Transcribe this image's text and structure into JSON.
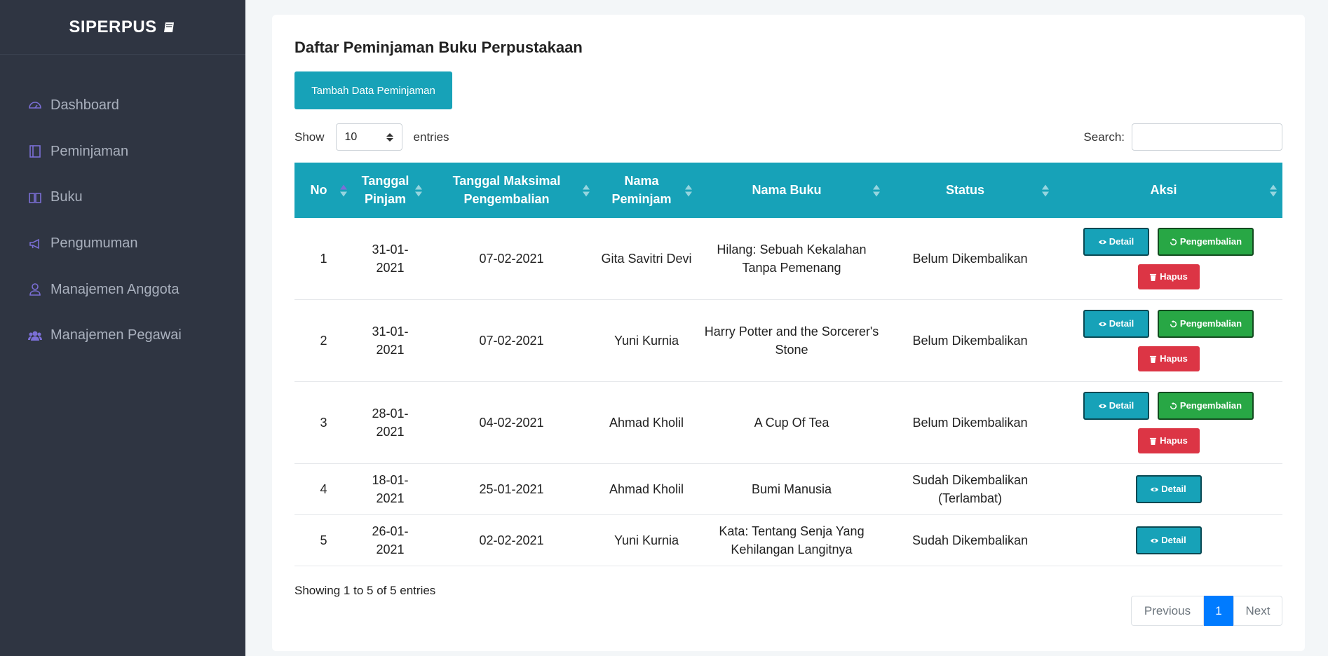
{
  "brand": "SIPERPUS",
  "nav": [
    {
      "label": "Dashboard",
      "icon": "dashboard-icon"
    },
    {
      "label": "Peminjaman",
      "icon": "ledger-icon"
    },
    {
      "label": "Buku",
      "icon": "book-open-icon"
    },
    {
      "label": "Pengumuman",
      "icon": "megaphone-icon"
    },
    {
      "label": "Manajemen Anggota",
      "icon": "user-icon"
    },
    {
      "label": "Manajemen Pegawai",
      "icon": "users-icon"
    }
  ],
  "page_title": "Daftar Peminjaman Buku Perpustakaan",
  "add_button": "Tambah Data Peminjaman",
  "length": {
    "show": "Show",
    "value": "10",
    "entries": "entries"
  },
  "search": {
    "label": "Search:",
    "value": ""
  },
  "columns": [
    "No",
    "Tanggal Pinjam",
    "Tanggal Maksimal Pengembalian",
    "Nama Peminjam",
    "Nama Buku",
    "Status",
    "Aksi"
  ],
  "rows": [
    {
      "no": "1",
      "tgl": "31-01-2021",
      "max": "07-02-2021",
      "nama": "Gita Savitri Devi",
      "buku": "Hilang: Sebuah Kekalahan Tanpa Pemenang",
      "status": "Belum Dikembalikan"
    },
    {
      "no": "2",
      "tgl": "31-01-2021",
      "max": "07-02-2021",
      "nama": "Yuni Kurnia",
      "buku": "Harry Potter and the Sorcerer's Stone",
      "status": "Belum Dikembalikan"
    },
    {
      "no": "3",
      "tgl": "28-01-2021",
      "max": "04-02-2021",
      "nama": "Ahmad Kholil",
      "buku": "A Cup Of Tea",
      "status": "Belum Dikembalikan"
    },
    {
      "no": "4",
      "tgl": "18-01-2021",
      "max": "25-01-2021",
      "nama": "Ahmad Kholil",
      "buku": "Bumi Manusia",
      "status": "Sudah Dikembalikan (Terlambat)"
    },
    {
      "no": "5",
      "tgl": "26-01-2021",
      "max": "02-02-2021",
      "nama": "Yuni Kurnia",
      "buku": "Kata: Tentang Senja Yang Kehilangan Langitnya",
      "status": "Sudah Dikembalikan"
    }
  ],
  "actions": {
    "detail": "Detail",
    "kembali": "Pengembalian",
    "hapus": "Hapus"
  },
  "info": "Showing 1 to 5 of 5 entries",
  "pager": {
    "prev": "Previous",
    "current": "1",
    "next": "Next"
  },
  "colors": {
    "sidebar": "#2f3542",
    "accent": "#17a2b8",
    "success": "#28a745",
    "danger": "#dc3545",
    "primary": "#007bff"
  }
}
